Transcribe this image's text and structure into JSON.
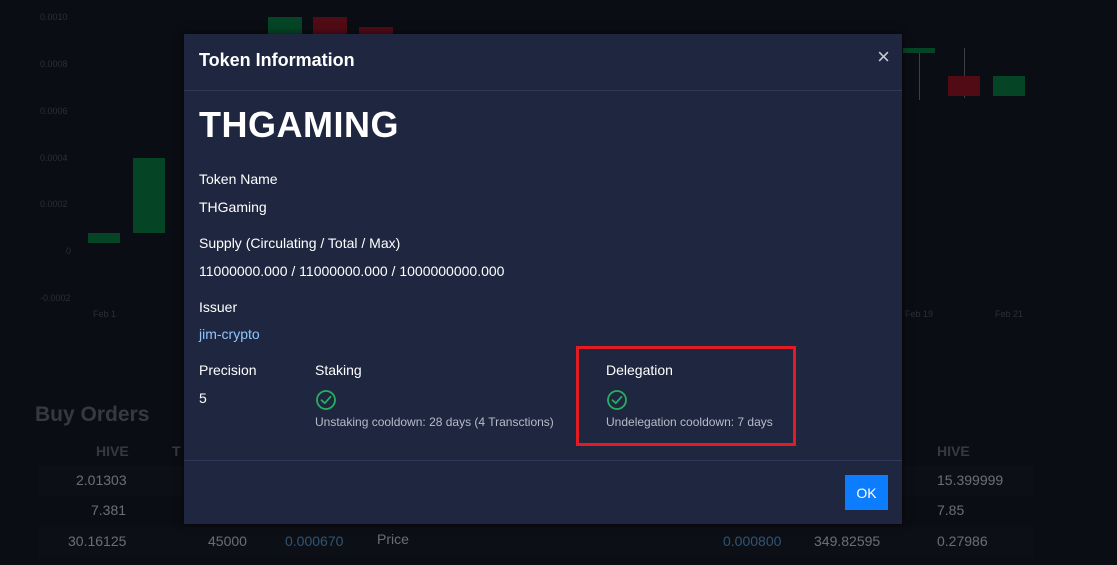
{
  "background": {
    "chart": {
      "y_ticks": [
        "0.0010",
        "0.0008",
        "0.0006",
        "0.0004",
        "0.0002",
        "0",
        "-0.0002"
      ],
      "x_ticks_left": [
        "Feb 1"
      ],
      "x_ticks_right": [
        "Feb 19",
        "Feb 21"
      ]
    },
    "buy_orders": {
      "title": "Buy Orders",
      "headers": {
        "hive": "HIVE",
        "t": "T",
        "hive_right": "HIVE"
      },
      "rows": [
        {
          "hive": "2.01303",
          "right": "15.399999"
        },
        {
          "hive": "7.381",
          "right": "7.85"
        },
        {
          "hive": "30.16125",
          "qty": "45000",
          "price": "0.000670",
          "mid_label": "Price",
          "price_right": "0.000800",
          "qty_right": "349.82595",
          "right": "0.27986"
        }
      ]
    }
  },
  "modal": {
    "title": "Token Information",
    "close": "×",
    "symbol": "THGAMING",
    "token_name_label": "Token Name",
    "token_name": "THGaming",
    "supply_label": "Supply (Circulating / Total / Max)",
    "supply": "11000000.000 / 11000000.000 / 1000000000.000",
    "issuer_label": "Issuer",
    "issuer": "jim-crypto",
    "precision_label": "Precision",
    "precision": "5",
    "staking_label": "Staking",
    "staking_note": "Unstaking cooldown: 28 days (4 Transctions)",
    "delegation_label": "Delegation",
    "delegation_note": "Undelegation cooldown: 7 days",
    "ok": "OK"
  },
  "colors": {
    "accent": "#0d7dff",
    "link": "#8ec6ff",
    "check": "#27ae60",
    "highlight": "#e31b23",
    "candle_up": "#0a8a4a",
    "candle_down": "#a3172b"
  }
}
